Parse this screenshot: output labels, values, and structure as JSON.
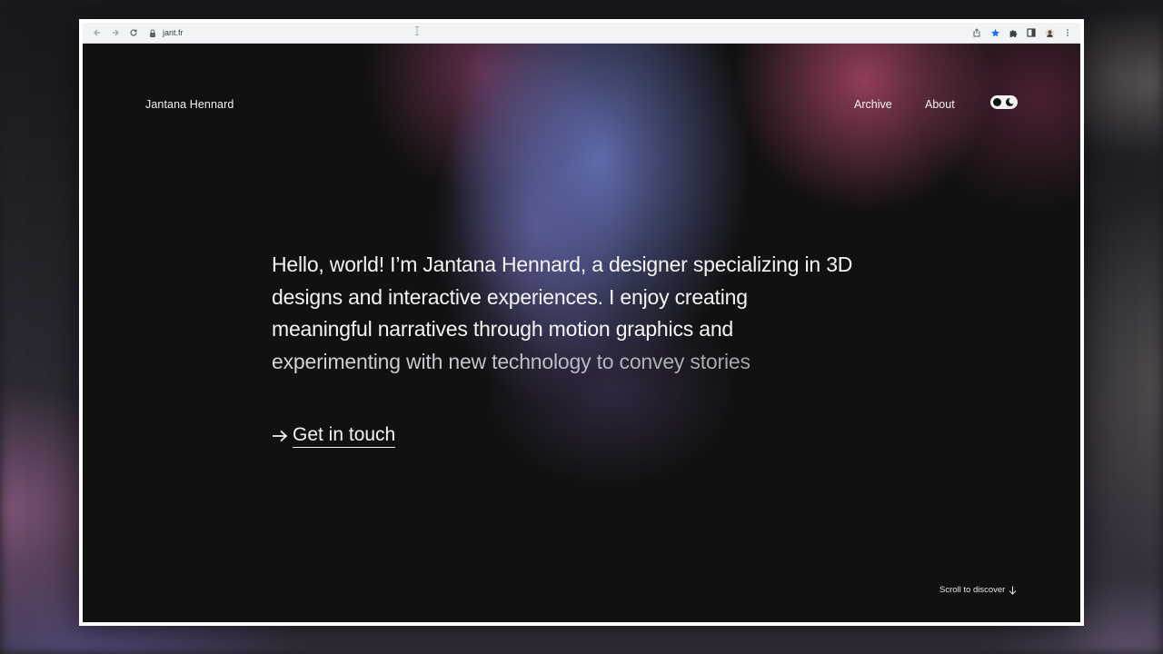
{
  "browser": {
    "url": "jant.fr",
    "back_icon": "arrow-left",
    "forward_icon": "arrow-right",
    "reload_icon": "reload",
    "lock_icon": "lock",
    "share_icon": "share",
    "bookmark_icon": "star",
    "extensions_icon": "puzzle",
    "sidepanel_icon": "side-panel",
    "profile_icon": "avatar",
    "menu_icon": "kebab-menu",
    "accent_color": "#1a73e8"
  },
  "site": {
    "name": "Jantana Hennard",
    "nav": {
      "archive": "Archive",
      "about": "About"
    },
    "theme_toggle_icon": "dark-mode-toggle"
  },
  "hero": {
    "lines": [
      "Hello, world! I’m Jantana Hennard, a designer specializing in 3D",
      "designs and interactive experiences. I enjoy creating",
      "meaningful narratives through motion graphics and",
      "experimenting with new technology to convey stories"
    ],
    "cta_arrow": "→",
    "cta_label": "Get in touch"
  },
  "footer": {
    "scroll_label": "Scroll to discover",
    "scroll_icon": "arrow-down"
  },
  "colors": {
    "page_background": "#121112",
    "text": "#f4f4f4",
    "glow_blue": "#626eb2",
    "glow_pink": "#c85078"
  }
}
